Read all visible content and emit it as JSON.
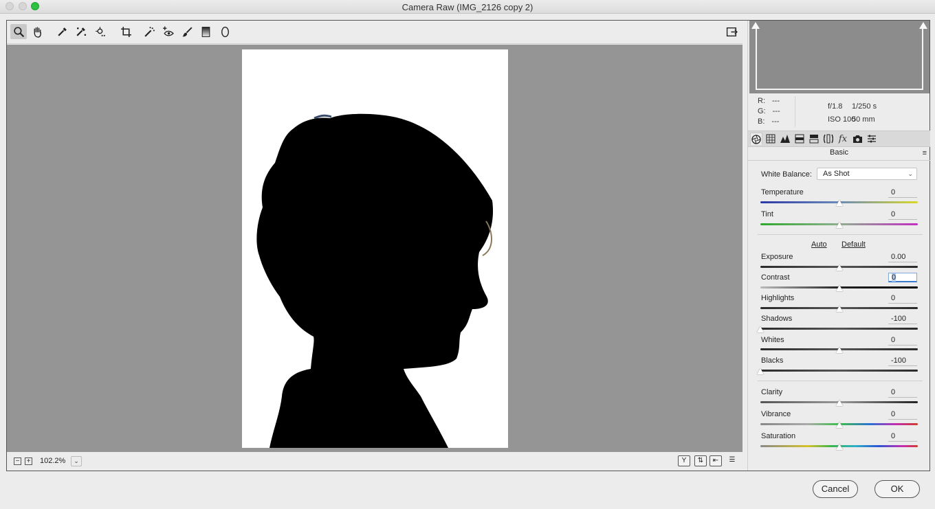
{
  "window": {
    "title": "Camera Raw (IMG_2126 copy 2)"
  },
  "toolbar": {
    "tools": [
      "zoom-tool",
      "hand-tool",
      "white-balance-tool",
      "color-sampler-tool",
      "targeted-adjustment-tool",
      "crop-tool",
      "straighten-tool",
      "spot-removal-tool",
      "red-eye-removal-tool",
      "adjustment-brush",
      "graduated-filter",
      "radial-filter"
    ],
    "active_tool": "zoom-tool"
  },
  "status": {
    "zoom_level": "102.2%",
    "zoom_out_label": "−",
    "zoom_in_label": "+"
  },
  "view_buttons": {
    "before_after_label": "Y"
  },
  "readout": {
    "r_label": "R:",
    "r_value": "---",
    "g_label": "G:",
    "g_value": "---",
    "b_label": "B:",
    "b_value": "---",
    "aperture": "f/1.8",
    "shutter": "1/250 s",
    "iso": "ISO 100",
    "focal": "50 mm"
  },
  "panel": {
    "section_title": "Basic",
    "white_balance_label": "White Balance:",
    "white_balance_value": "As Shot",
    "auto_label": "Auto",
    "default_label": "Default",
    "sliders": {
      "temperature": {
        "label": "Temperature",
        "value": "0",
        "position": 0.5
      },
      "tint": {
        "label": "Tint",
        "value": "0",
        "position": 0.5
      },
      "exposure": {
        "label": "Exposure",
        "value": "0.00",
        "position": 0.5
      },
      "contrast": {
        "label": "Contrast",
        "value": "0",
        "position": 0.5
      },
      "highlights": {
        "label": "Highlights",
        "value": "0",
        "position": 0.5
      },
      "shadows": {
        "label": "Shadows",
        "value": "-100",
        "position": 0.0
      },
      "whites": {
        "label": "Whites",
        "value": "0",
        "position": 0.5
      },
      "blacks": {
        "label": "Blacks",
        "value": "-100",
        "position": 0.0
      },
      "clarity": {
        "label": "Clarity",
        "value": "0",
        "position": 0.5
      },
      "vibrance": {
        "label": "Vibrance",
        "value": "0",
        "position": 0.5
      },
      "saturation": {
        "label": "Saturation",
        "value": "0",
        "position": 0.5
      }
    }
  },
  "buttons": {
    "cancel": "Cancel",
    "ok": "OK"
  }
}
